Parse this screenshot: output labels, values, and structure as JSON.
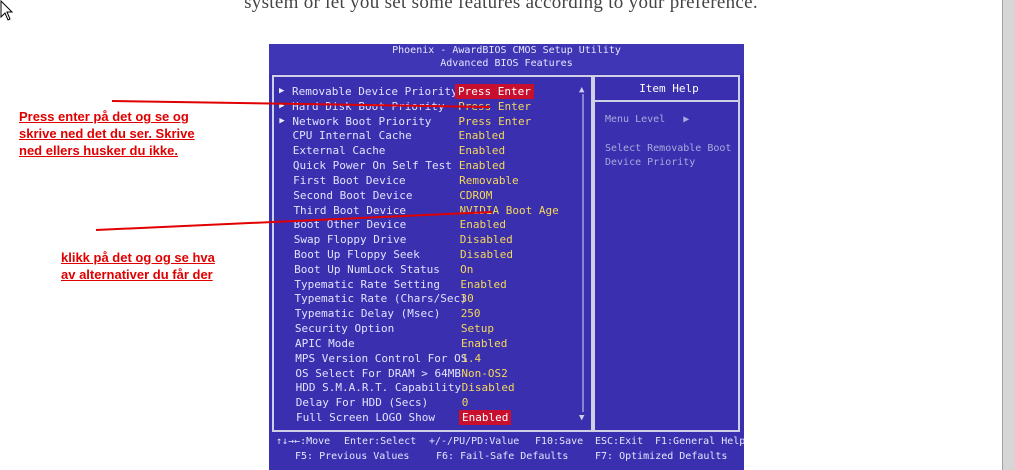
{
  "intro_text": "system or let you set some features according to your preference.",
  "bios": {
    "title": "Phoenix - AwardBIOS CMOS Setup Utility",
    "subtitle": "Advanced BIOS Features",
    "help_title": "Item Help",
    "menu_level": "Menu Level",
    "menu_level_arrow": "▶",
    "help_line1": "Select Removable Boot",
    "help_line2": "Device Priority",
    "rows": [
      {
        "arrow": "▶",
        "label": "Removable Device Priority",
        "value": "Press Enter",
        "highlighted": true
      },
      {
        "arrow": "▶",
        "label": "Hard Disk Boot Priority",
        "value": "Press Enter",
        "highlighted": false
      },
      {
        "arrow": "▶",
        "label": "Network Boot Priority",
        "value": "Press Enter",
        "highlighted": false
      },
      {
        "arrow": "",
        "label": "CPU Internal Cache",
        "value": "Enabled",
        "highlighted": false
      },
      {
        "arrow": "",
        "label": "External Cache",
        "value": "Enabled",
        "highlighted": false
      },
      {
        "arrow": "",
        "label": "Quick Power On Self Test",
        "value": "Enabled",
        "highlighted": false
      },
      {
        "arrow": "",
        "label": "First Boot Device",
        "value": "Removable",
        "highlighted": false
      },
      {
        "arrow": "",
        "label": "Second Boot Device",
        "value": "CDROM",
        "highlighted": false
      },
      {
        "arrow": "",
        "label": "Third Boot Device",
        "value": "NVIDIA Boot Age",
        "highlighted": false
      },
      {
        "arrow": "",
        "label": "Boot Other Device",
        "value": "Enabled",
        "highlighted": false
      },
      {
        "arrow": "",
        "label": "Swap Floppy Drive",
        "value": "Disabled",
        "highlighted": false
      },
      {
        "arrow": "",
        "label": "Boot Up Floppy Seek",
        "value": "Disabled",
        "highlighted": false
      },
      {
        "arrow": "",
        "label": "Boot Up NumLock Status",
        "value": "On",
        "highlighted": false
      },
      {
        "arrow": "",
        "label": "Typematic Rate Setting",
        "value": "Enabled",
        "highlighted": false
      },
      {
        "arrow": "",
        "label": "Typematic Rate (Chars/Sec)",
        "value": "30",
        "highlighted": false
      },
      {
        "arrow": "",
        "label": "Typematic Delay (Msec)",
        "value": "250",
        "highlighted": false
      },
      {
        "arrow": "",
        "label": "Security Option",
        "value": "Setup",
        "highlighted": false
      },
      {
        "arrow": "",
        "label": "APIC Mode",
        "value": "Enabled",
        "highlighted": false
      },
      {
        "arrow": "",
        "label": "MPS Version Control For OS",
        "value": "1.4",
        "highlighted": false
      },
      {
        "arrow": "",
        "label": "OS Select For DRAM > 64MB",
        "value": "Non-OS2",
        "highlighted": false
      },
      {
        "arrow": "",
        "label": "HDD S.M.A.R.T. Capability",
        "value": "Disabled",
        "highlighted": false
      },
      {
        "arrow": "",
        "label": "Delay For HDD (Secs)",
        "value": "0",
        "highlighted": false
      },
      {
        "arrow": "",
        "label": "Full Screen LOGO Show",
        "value": "Enabled",
        "highlighted": true
      }
    ],
    "scroll_up": "▲",
    "scroll_down": "▼",
    "footer": {
      "move": "↑↓→←:Move",
      "enter": "Enter:Select",
      "value": "+/-/PU/PD:Value",
      "save": "F10:Save",
      "exit": "ESC:Exit",
      "general_help": "F1:General Help",
      "previous": "F5: Previous Values",
      "failsafe": "F6: Fail-Safe Defaults",
      "optimized": "F7: Optimized Defaults"
    }
  },
  "annotations": {
    "note1": [
      "Press enter på det og se og",
      "skrive ned det du ser. Skrive",
      "ned ellers husker du ikke."
    ],
    "note2": [
      "klikk på det og og se hva",
      "av alternativer du får der"
    ],
    "color": "#e00000"
  },
  "colors": {
    "bios_background": "#3a2fae",
    "value_yellow": "#f4d85a",
    "highlight_red": "#c8102e"
  }
}
